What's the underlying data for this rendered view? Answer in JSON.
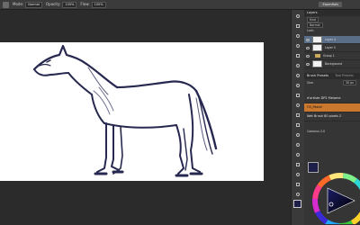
{
  "options_bar": {
    "mode_label": "Mode:",
    "mode_value": "Normal",
    "opacity_label": "Opacity:",
    "opacity_value": "100%",
    "flow_label": "Flow:",
    "flow_value": "100%",
    "workspace_label": "Essentials"
  },
  "panels": {
    "layers_tab": "Layers",
    "kind_label": "Kind",
    "blend_mode": "Normal",
    "lock_label": "Lock:",
    "layers": [
      {
        "name": "Layer 4",
        "selected": true,
        "type": "layer"
      },
      {
        "name": "Layer 5",
        "selected": false,
        "type": "layer"
      },
      {
        "name": "Group 1",
        "selected": false,
        "type": "group"
      },
      {
        "name": "Background",
        "selected": false,
        "type": "layer"
      }
    ],
    "brush_tabs": [
      "Brush Presets",
      "Tool Presets"
    ],
    "size_label": "Size:",
    "size_value": "30 px",
    "brush_presets": [
      {
        "name": "d'artiste DP2 Melame",
        "active": false
      },
      {
        "name": "Oli_Pastel",
        "active": true
      },
      {
        "name": "Wet Brush 80 pixels 2",
        "active": false
      }
    ],
    "color_label": "Coolorus 2.0"
  },
  "colors": {
    "foreground": "#1d1f4a",
    "background": "#ffffff",
    "selected_layer": "#5b6e88",
    "active_preset": "#c9782d"
  }
}
